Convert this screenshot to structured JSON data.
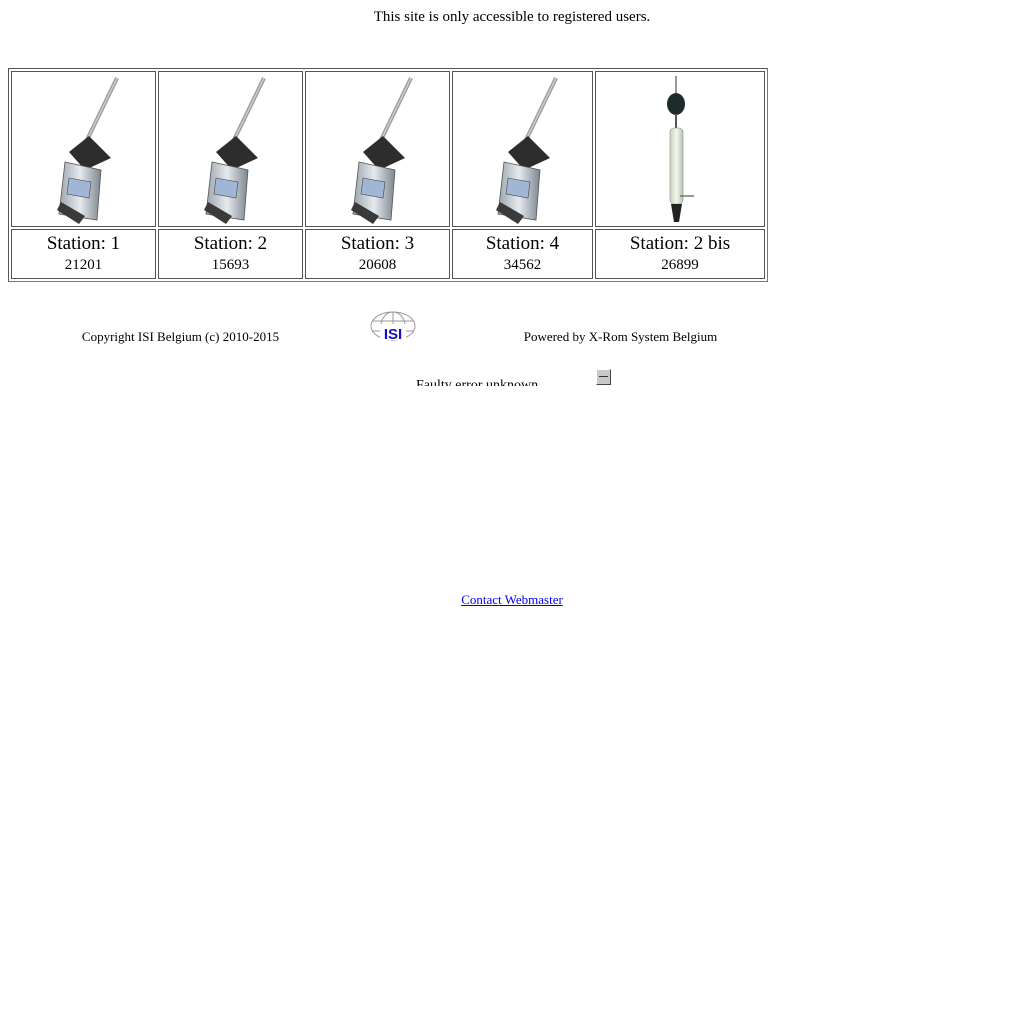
{
  "notice": "This site is only accessible to registered users.",
  "stations": [
    {
      "name": "Station: 1",
      "count": "21201",
      "icon": "sound-level-meter-icon"
    },
    {
      "name": "Station: 2",
      "count": "15693",
      "icon": "sound-level-meter-icon"
    },
    {
      "name": "Station: 3",
      "count": "20608",
      "icon": "sound-level-meter-icon"
    },
    {
      "name": "Station: 4",
      "count": "34562",
      "icon": "sound-level-meter-icon"
    },
    {
      "name": "Station: 2 bis",
      "count": "26899",
      "icon": "outdoor-microphone-icon"
    }
  ],
  "footer": {
    "copyright": "Copyright ISI Belgium (c) 2010-2015",
    "logo_text": "ISI",
    "powered_by": "Powered by X-Rom System Belgium"
  },
  "status": {
    "text": "Faulty error unknown"
  },
  "contact": {
    "link_text": "Contact Webmaster"
  },
  "colors": {
    "link": "#0000ee",
    "logo_blue": "#1010cc"
  }
}
